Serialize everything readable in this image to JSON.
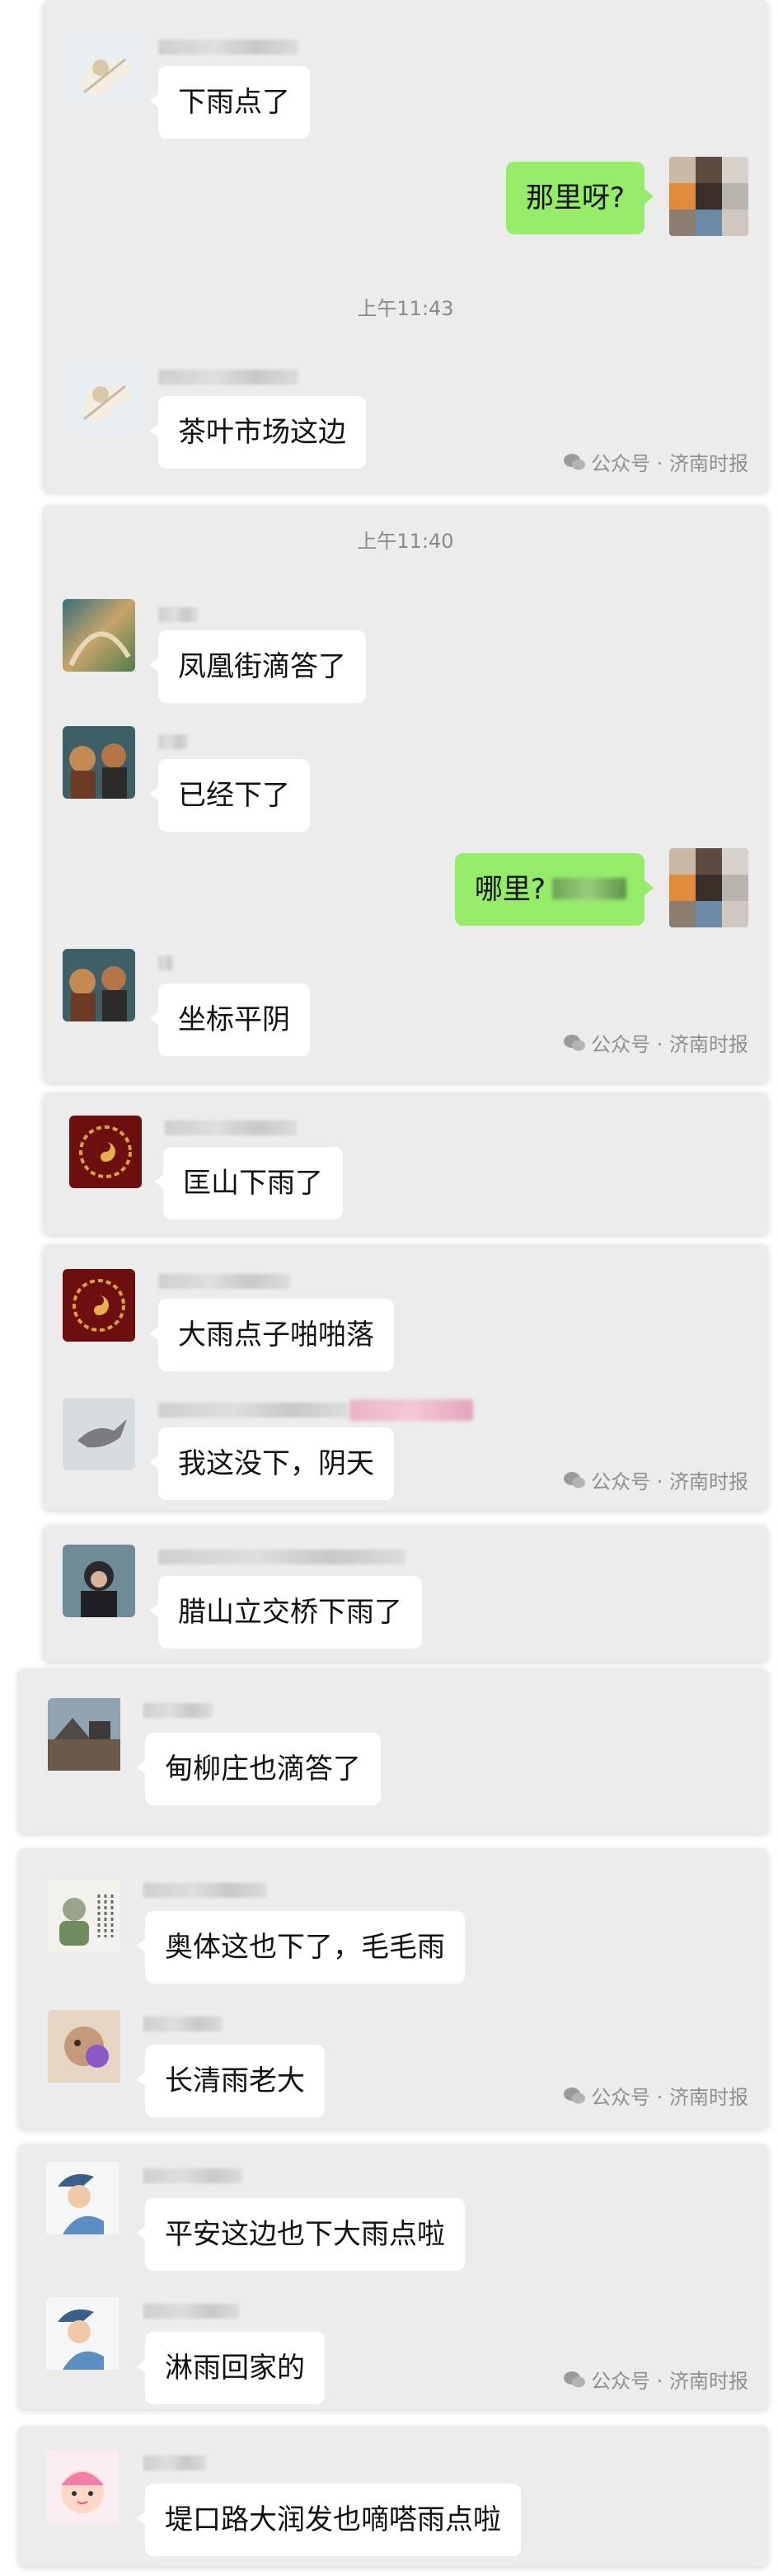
{
  "watermark": {
    "text": "公众号 · 济南时报"
  },
  "panels": [
    {
      "time": "上午11:43",
      "messages": [
        {
          "text": "下雨点了"
        },
        {
          "text": "那里呀?"
        },
        {
          "text": "茶叶市场这边"
        }
      ]
    },
    {
      "time": "上午11:40",
      "messages": [
        {
          "text": "凤凰街滴答了"
        },
        {
          "text": "已经下了"
        },
        {
          "text": "哪里?"
        },
        {
          "text": "坐标平阴"
        }
      ]
    },
    {
      "messages": [
        {
          "text": "匡山下雨了"
        }
      ]
    },
    {
      "messages": [
        {
          "text": "大雨点子啪啪落"
        },
        {
          "text": "我这没下，阴天"
        }
      ]
    },
    {
      "messages": [
        {
          "text": "腊山立交桥下雨了"
        }
      ]
    },
    {
      "messages": [
        {
          "text": "甸柳庄也滴答了"
        }
      ]
    },
    {
      "messages": [
        {
          "text": "奥体这也下了，毛毛雨"
        },
        {
          "text": "长清雨老大"
        }
      ]
    },
    {
      "messages": [
        {
          "text": "平安这边也下大雨点啦"
        },
        {
          "text": "淋雨回家的"
        }
      ]
    },
    {
      "messages": [
        {
          "text": "堤口路大润发也嘀嗒雨点啦"
        }
      ]
    }
  ],
  "colors": {
    "bubble_self": "#95ec69",
    "bubble_other": "#ffffff",
    "panel": "#ececec"
  }
}
